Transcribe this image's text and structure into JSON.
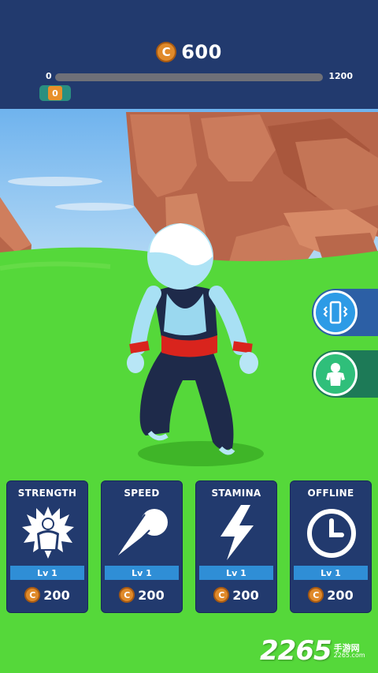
{
  "hud": {
    "coins": "600",
    "coin_icon_glyph": "C",
    "progress": {
      "min": "0",
      "max": "1200",
      "fill_fraction": 0.0
    },
    "level_badge": "0"
  },
  "side_buttons": {
    "vibrate": "vibrate-phone-icon",
    "skins": "character-skin-icon"
  },
  "upgrades": [
    {
      "title": "STRENGTH",
      "level": "Lv 1",
      "price": "200",
      "icon": "power-aura-icon"
    },
    {
      "title": "SPEED",
      "level": "Lv 1",
      "price": "200",
      "icon": "comet-icon"
    },
    {
      "title": "STAMINA",
      "level": "Lv 1",
      "price": "200",
      "icon": "lightning-icon"
    },
    {
      "title": "OFFLINE",
      "level": "Lv 1",
      "price": "200",
      "icon": "clock-icon"
    }
  ],
  "watermark": {
    "digits": "2265",
    "cn": "手游网",
    "url": "2265.com"
  },
  "colors": {
    "hud_bg": "#223a6e",
    "coin": "#e08a2a",
    "level_bar": "#2f8ed6",
    "grass": "#55d83a",
    "sky": "#76b8ee",
    "rock": "#b8664a"
  }
}
